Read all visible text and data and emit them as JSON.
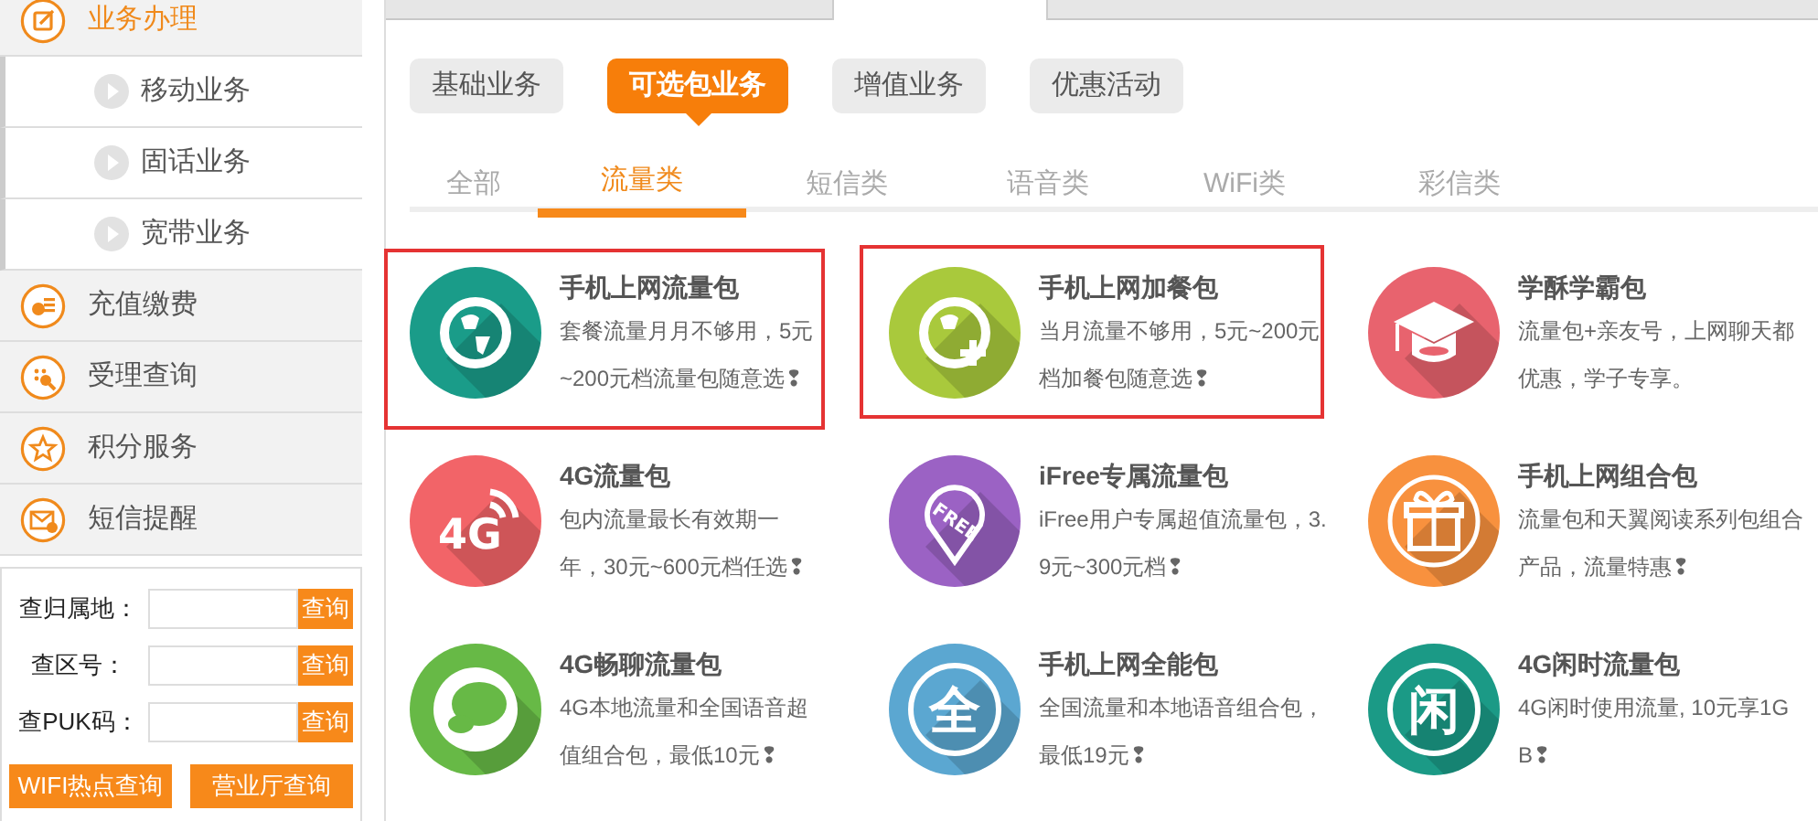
{
  "sidebar": {
    "items": [
      {
        "label": "业务办理",
        "kind": "main",
        "selected": true
      },
      {
        "label": "移动业务",
        "kind": "sub",
        "selected": false
      },
      {
        "label": "固话业务",
        "kind": "sub",
        "selected": false
      },
      {
        "label": "宽带业务",
        "kind": "sub",
        "selected": false
      },
      {
        "label": "充值缴费",
        "kind": "main",
        "selected": false
      },
      {
        "label": "受理查询",
        "kind": "main",
        "selected": false
      },
      {
        "label": "积分服务",
        "kind": "main",
        "selected": false
      },
      {
        "label": "短信提醒",
        "kind": "main",
        "selected": false
      }
    ]
  },
  "lookup": {
    "rows": [
      {
        "label": "查归属地：",
        "button": "查询"
      },
      {
        "label": "查区号：",
        "button": "查询"
      },
      {
        "label": "查PUK码：",
        "button": "查询"
      }
    ],
    "buttons": [
      "WIFI热点查询",
      "营业厅查询"
    ]
  },
  "top_tabs": [
    {
      "selected": false
    },
    {
      "selected": false
    },
    {
      "selected": true
    },
    {
      "selected": false
    }
  ],
  "categories": [
    {
      "label": "基础业务",
      "selected": false
    },
    {
      "label": "可选包业务",
      "selected": true
    },
    {
      "label": "增值业务",
      "selected": false
    },
    {
      "label": "优惠活动",
      "selected": false
    }
  ],
  "subtabs": [
    {
      "label": "全部",
      "selected": false
    },
    {
      "label": "流量类",
      "selected": true
    },
    {
      "label": "短信类",
      "selected": false
    },
    {
      "label": "语音类",
      "selected": false
    },
    {
      "label": "WiFi类",
      "selected": false
    },
    {
      "label": "彩信类",
      "selected": false
    }
  ],
  "packages": [
    {
      "title": "手机上网流量包",
      "description": "套餐流量月月不够用，5元~200元档流量包随意选❢",
      "color": "#1a9c89",
      "highlighted": true
    },
    {
      "title": "手机上网加餐包",
      "description": "当月流量不够用，5元~200元档加餐包随意选❢",
      "color": "#a9c93c",
      "highlighted": true
    },
    {
      "title": "学酥学霸包",
      "description": "流量包+亲友号，上网聊天都优惠，学子专享。",
      "color": "#e8636e",
      "highlighted": false
    },
    {
      "title": "4G流量包",
      "description": "包内流量最长有效期一年，30元~600元档任选❢",
      "icon_text": "4G",
      "color": "#f26468",
      "highlighted": false
    },
    {
      "title": "iFree专属流量包",
      "description": "iFree用户专属超值流量包，3.9元~300元档❢",
      "icon_text": "FREE",
      "color": "#9b62c4",
      "highlighted": false
    },
    {
      "title": "手机上网组合包",
      "description": "流量包和天翼阅读系列包组合产品，流量特惠❢",
      "color": "#f8913e",
      "highlighted": false
    },
    {
      "title": "4G畅聊流量包",
      "description": "4G本地流量和全国语音超值组合包，最低10元❢",
      "color": "#67b946",
      "highlighted": false
    },
    {
      "title": "手机上网全能包",
      "description": "全国流量和本地语音组合包，最低19元❢",
      "icon_text": "全",
      "color": "#5ba7d1",
      "highlighted": false
    },
    {
      "title": "4G闲时流量包",
      "description": "4G闲时使用流量, 10元享1GB❢",
      "icon_text": "闲",
      "color": "#1b9a86",
      "highlighted": false
    }
  ]
}
